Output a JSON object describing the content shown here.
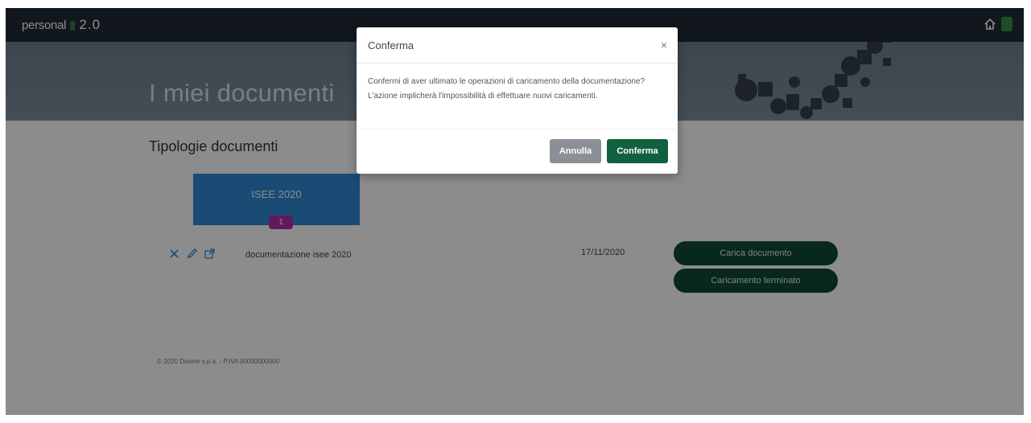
{
  "navbar": {
    "brand_personal": "personal",
    "brand_version": "2.0",
    "home_icon": "home-icon",
    "user_icon": "user-icon"
  },
  "hero": {
    "title": "I miei documenti"
  },
  "content": {
    "section_title": "Tipologie documenti",
    "tile": {
      "label": "ISEE 2020",
      "badge": "1"
    },
    "document_row": {
      "name": "documentazione isee 2020",
      "date": "17/11/2020",
      "actions": [
        "delete-icon",
        "edit-icon",
        "external-link-icon"
      ]
    },
    "buttons": {
      "carica": "Carica documento",
      "terminato": "Caricamento terminato"
    },
    "footer": "© 2020 Dasme s.p.a. - P.IVA 00000000000"
  },
  "modal": {
    "title": "Conferma",
    "close": "×",
    "body": "Confermi di aver ultimato le operazioni di caricamento della documentazione? L'azione implicherà l'impossibilità di effettuare nuovi caricamenti.",
    "cancel_label": "Annulla",
    "confirm_label": "Conferma"
  },
  "colors": {
    "navbar": "#1f2a35",
    "tile": "#2e89d6",
    "badge": "#b02fa7",
    "primary_green": "#11613e",
    "pill_green": "#0e4a32",
    "cancel_grey": "#8b9097"
  }
}
